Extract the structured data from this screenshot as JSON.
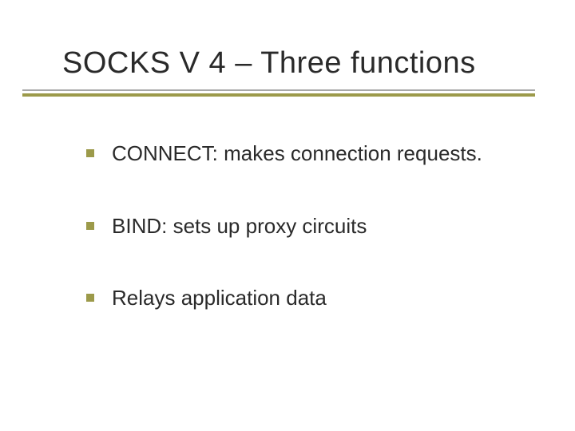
{
  "slide": {
    "title": "SOCKS V 4 – Three functions",
    "items": [
      "CONNECT: makes connection requests.",
      "BIND: sets up proxy circuits",
      "Relays application data"
    ]
  }
}
